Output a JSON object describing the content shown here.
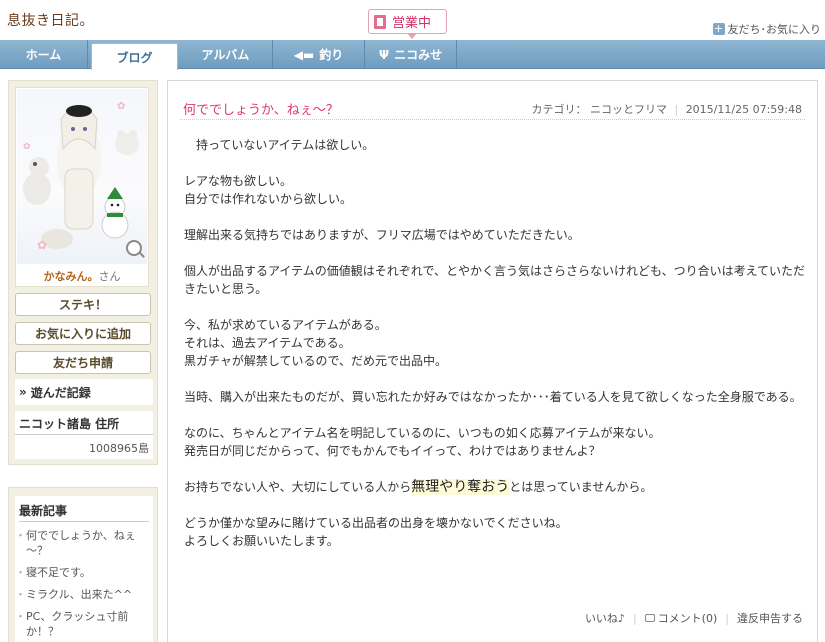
{
  "header": {
    "site_title": "息抜き日記。",
    "open_badge": "営業中",
    "friends_link": "友だち･お気に入り"
  },
  "nav": {
    "tabs": [
      {
        "label": "ホーム"
      },
      {
        "label": "ブログ"
      },
      {
        "label": "アルバム"
      },
      {
        "label": "釣り"
      },
      {
        "label": "ニコみせ"
      }
    ]
  },
  "profile": {
    "name": "かなみん。",
    "suffix": "さん",
    "buttons": [
      "ステキ！",
      "お気に入りに追加",
      "友だち申請"
    ],
    "played_label": "遊んだ記録",
    "island_label": "ニコット諸島 住所",
    "island_value": "1008965島"
  },
  "recent": {
    "title": "最新記事",
    "items": [
      "何ででしょうか、ねぇ～？",
      "寝不足です。",
      "ミラクル、出来た^^",
      "PC、クラッシュ寸前か！？"
    ]
  },
  "post": {
    "title": "何ででしょうか、ねぇ～？",
    "category_label": "カテゴリ：",
    "category": "ニコッとフリマ",
    "datetime": "2015/11/25 07:59:48",
    "paragraphs": [
      "　持っていないアイテムは欲しい。",
      "レアな物も欲しい。\n自分では作れないから欲しい。",
      "理解出来る気持ちではありますが、フリマ広場ではやめていただきたい。",
      "個人が出品するアイテムの価値観はそれぞれで、とやかく言う気はさらさらないけれども、つり合いは考えていただきたいと思う。",
      "今、私が求めているアイテムがある。\nそれは、過去アイテムである。\n黒ガチャが解禁しているので、だめ元で出品中。",
      "当時、購入が出来たものだが、買い忘れたか好みではなかったか･･･着ている人を見て欲しくなった全身服である。",
      "なのに、ちゃんとアイテム名を明記しているのに、いつもの如く応募アイテムが来ない。\n発売日が同じだからって、何でもかんでもイイって、わけではありませんよ？"
    ],
    "emphasis_before": "お持ちでない人や、大切にしている人から",
    "emphasis": "無理やり奪おう",
    "emphasis_after": "とは思っていませんから。",
    "closing": "どうか僅かな望みに賭けている出品者の出身を壊かないでくださいね。\nよろしくお願いいたします。",
    "footer": {
      "like": "いいね♪",
      "comment": "コメント(0)",
      "report": "違反申告する"
    }
  }
}
